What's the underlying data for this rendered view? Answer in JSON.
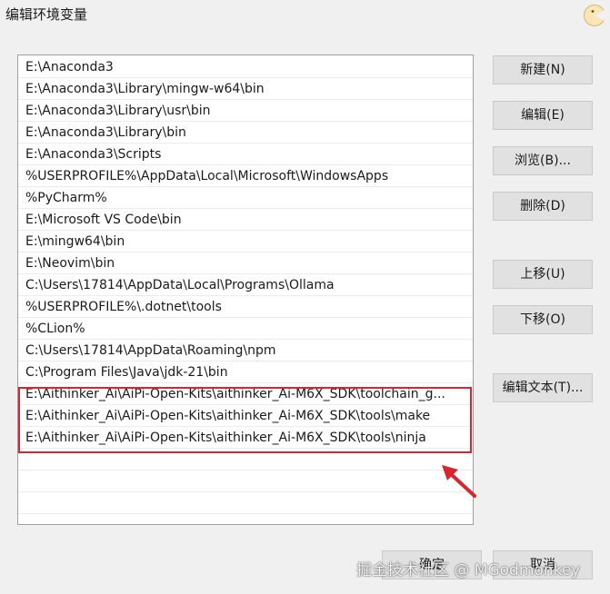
{
  "window": {
    "title": "编辑环境变量"
  },
  "path_list": {
    "items": [
      "E:\\Anaconda3",
      "E:\\Anaconda3\\Library\\mingw-w64\\bin",
      "E:\\Anaconda3\\Library\\usr\\bin",
      "E:\\Anaconda3\\Library\\bin",
      "E:\\Anaconda3\\Scripts",
      "%USERPROFILE%\\AppData\\Local\\Microsoft\\WindowsApps",
      "%PyCharm%",
      "E:\\Microsoft VS Code\\bin",
      "E:\\mingw64\\bin",
      "E:\\Neovim\\bin",
      "C:\\Users\\17814\\AppData\\Local\\Programs\\Ollama",
      "%USERPROFILE%\\.dotnet\\tools",
      "%CLion%",
      "C:\\Users\\17814\\AppData\\Roaming\\npm",
      "C:\\Program Files\\Java\\jdk-21\\bin",
      "E:\\Aithinker_Ai\\AiPi-Open-Kits\\aithinker_Ai-M6X_SDK\\toolchain_g...",
      "E:\\Aithinker_Ai\\AiPi-Open-Kits\\aithinker_Ai-M6X_SDK\\tools\\make",
      "E:\\Aithinker_Ai\\AiPi-Open-Kits\\aithinker_Ai-M6X_SDK\\tools\\ninja"
    ]
  },
  "buttons": {
    "new": "新建(N)",
    "edit": "编辑(E)",
    "browse": "浏览(B)...",
    "delete": "删除(D)",
    "move_up": "上移(U)",
    "move_down": "下移(O)",
    "edit_text": "编辑文本(T)...",
    "ok": "确定",
    "cancel": "取消"
  },
  "watermark": "掘金技术社区 @ MGodmonkey",
  "colors": {
    "highlight": "#d9262e",
    "arrow": "#d9262e"
  }
}
